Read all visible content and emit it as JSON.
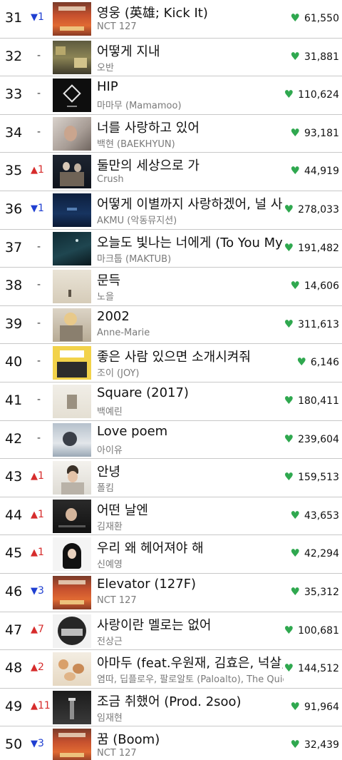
{
  "colors": {
    "up": "#d62c2c",
    "down": "#1f3fd1",
    "heart": "#2fa84f",
    "divider": "#c8c8c8"
  },
  "icons": {
    "like": "heart-icon",
    "up": "triangle-up-icon",
    "down": "triangle-down-icon"
  },
  "rows": [
    {
      "rank": "31",
      "dir": "down",
      "change": "1",
      "title": "영웅 (英雄; Kick It)",
      "artist": "NCT 127",
      "likes": "61,550",
      "cover": "nct-red"
    },
    {
      "rank": "32",
      "dir": "same",
      "change": "-",
      "title": "어떻게 지내",
      "artist": "오반",
      "likes": "31,881",
      "cover": "room"
    },
    {
      "rank": "33",
      "dir": "same",
      "change": "-",
      "title": "HIP",
      "artist": "마마무 (Mamamoo)",
      "likes": "110,624",
      "cover": "black-logo"
    },
    {
      "rank": "34",
      "dir": "same",
      "change": "-",
      "title": "너를 사랑하고 있어",
      "artist": "백현 (BAEKHYUN)",
      "likes": "93,181",
      "cover": "soft-portrait"
    },
    {
      "rank": "35",
      "dir": "up",
      "change": "1",
      "title": "둘만의 세상으로 가",
      "artist": "Crush",
      "likes": "44,919",
      "cover": "dark-couple"
    },
    {
      "rank": "36",
      "dir": "down",
      "change": "1",
      "title": "어떻게 이별까지 사랑하겠어, 널 사랑하는 거지",
      "artist": "AKMU (악동뮤지션)",
      "likes": "278,033",
      "cover": "navy"
    },
    {
      "rank": "37",
      "dir": "same",
      "change": "-",
      "title": "오늘도 빛나는 너에게 (To You My Light)",
      "artist": "마크툽 (MAKTUB)",
      "likes": "191,482",
      "cover": "dark-teal"
    },
    {
      "rank": "38",
      "dir": "same",
      "change": "-",
      "title": "문득",
      "artist": "노을",
      "likes": "14,606",
      "cover": "beige"
    },
    {
      "rank": "39",
      "dir": "same",
      "change": "-",
      "title": "2002",
      "artist": "Anne-Marie",
      "likes": "311,613",
      "cover": "anne"
    },
    {
      "rank": "40",
      "dir": "same",
      "change": "-",
      "title": "좋은 사람 있으면 소개시켜줘",
      "artist": "조이 (JOY)",
      "likes": "6,146",
      "cover": "yellow"
    },
    {
      "rank": "41",
      "dir": "same",
      "change": "-",
      "title": "Square (2017)",
      "artist": "백예린",
      "likes": "180,411",
      "cover": "pale-square"
    },
    {
      "rank": "42",
      "dir": "same",
      "change": "-",
      "title": "Love poem",
      "artist": "아이유",
      "likes": "239,604",
      "cover": "blue-grey"
    },
    {
      "rank": "43",
      "dir": "up",
      "change": "1",
      "title": "안녕",
      "artist": "폴킴",
      "likes": "159,513",
      "cover": "light-portrait"
    },
    {
      "rank": "44",
      "dir": "up",
      "change": "1",
      "title": "어떤 날엔",
      "artist": "김재환",
      "likes": "43,653",
      "cover": "dark-portrait"
    },
    {
      "rank": "45",
      "dir": "up",
      "change": "1",
      "title": "우리 왜 헤어져야 해",
      "artist": "신예영",
      "likes": "42,294",
      "cover": "silhouette"
    },
    {
      "rank": "46",
      "dir": "down",
      "change": "3",
      "title": "Elevator (127F)",
      "artist": "NCT 127",
      "likes": "35,312",
      "cover": "nct-red"
    },
    {
      "rank": "47",
      "dir": "up",
      "change": "7",
      "title": "사랑이란 멜로는 없어",
      "artist": "전상근",
      "likes": "100,681",
      "cover": "circle-city"
    },
    {
      "rank": "48",
      "dir": "up",
      "change": "2",
      "title": "아마두 (feat.우원재, 김효은, 넉살, Huckleberry P)",
      "artist": "염따, 딥플로우, 팔로알토 (Paloalto), The Quiett, 사이먼 도미닉",
      "likes": "144,512",
      "cover": "hands"
    },
    {
      "rank": "49",
      "dir": "up",
      "change": "11",
      "title": "조금 취했어 (Prod. 2soo)",
      "artist": "임재현",
      "likes": "91,964",
      "cover": "night-street"
    },
    {
      "rank": "50",
      "dir": "down",
      "change": "3",
      "title": "꿈 (Boom)",
      "artist": "NCT 127",
      "likes": "32,439",
      "cover": "nct-red"
    }
  ]
}
